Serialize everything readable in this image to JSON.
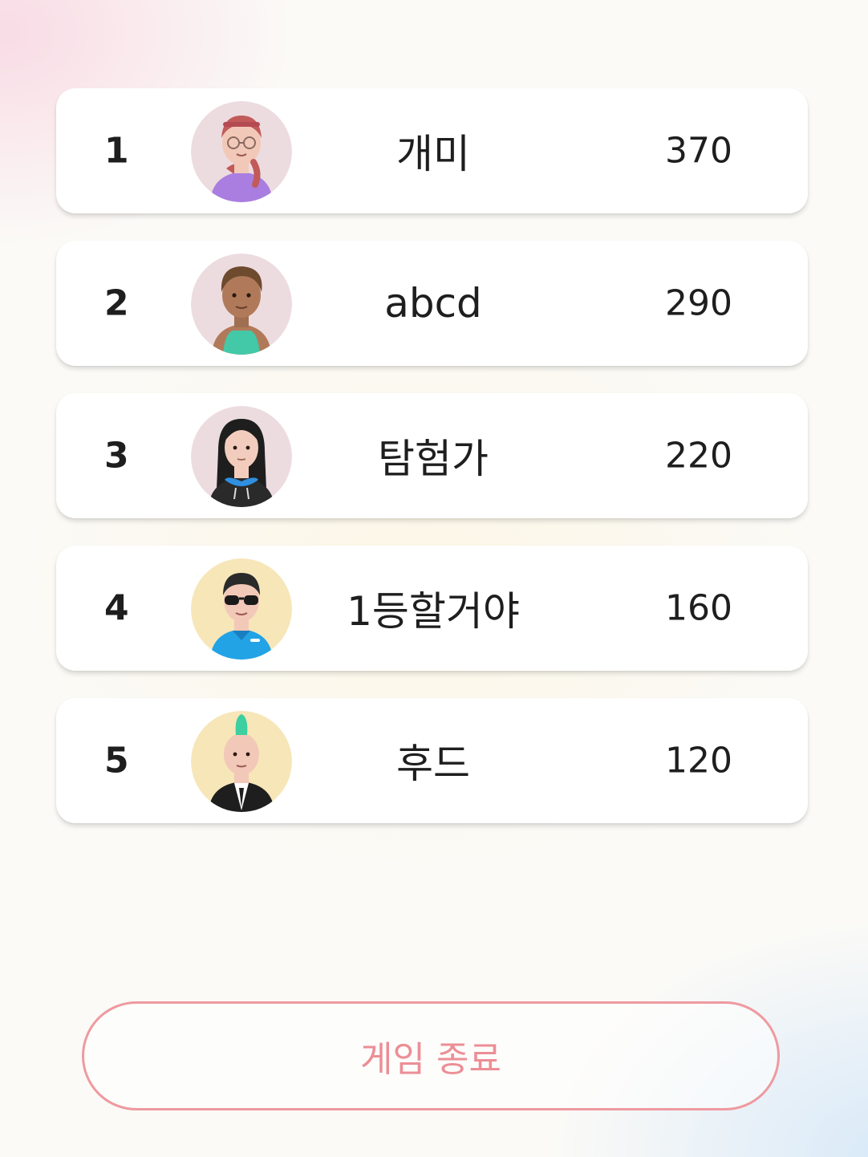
{
  "ranking": [
    {
      "rank": "1",
      "name": "개미",
      "score": "370",
      "avatar": {
        "icon": "avatar-glasses-braid-icon",
        "bg": "#ecdcdf",
        "skin": "#f2c8b8",
        "hair": "#c25a5a",
        "shirt": "#a97ee0"
      }
    },
    {
      "rank": "2",
      "name": "abcd",
      "score": "290",
      "avatar": {
        "icon": "avatar-tank-top-icon",
        "bg": "#ecdcdf",
        "skin": "#b07a5a",
        "hair": "#6e4a2e",
        "shirt": "#43c9a8"
      }
    },
    {
      "rank": "3",
      "name": "탐험가",
      "score": "220",
      "avatar": {
        "icon": "avatar-long-hair-hoodie-icon",
        "bg": "#ecdcdf",
        "skin": "#f2cdbd",
        "hair": "#1e1e1e",
        "shirt": "#2a2a2a"
      }
    },
    {
      "rank": "4",
      "name": "1등할거야",
      "score": "160",
      "avatar": {
        "icon": "avatar-sunglasses-icon",
        "bg": "#f7e6b8",
        "skin": "#f2c8b8",
        "hair": "#2a2a2a",
        "shirt": "#22a3e6"
      }
    },
    {
      "rank": "5",
      "name": "후드",
      "score": "120",
      "avatar": {
        "icon": "avatar-mohawk-icon",
        "bg": "#f7e6b8",
        "skin": "#f2c8b8",
        "hair": "#3ccfa0",
        "shirt": "#1e1e1e"
      }
    }
  ],
  "end_button": {
    "label": "게임 종료",
    "color": "#ec8e96"
  }
}
